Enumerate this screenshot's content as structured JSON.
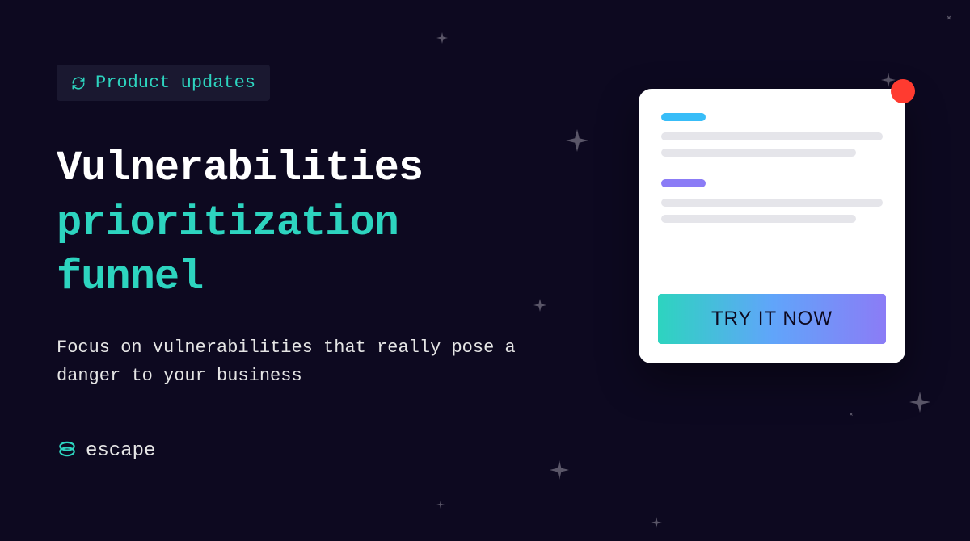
{
  "badge": {
    "label": "Product updates"
  },
  "title": {
    "line1": "Vulnerabilities",
    "line2": "prioritization",
    "line3": "funnel"
  },
  "subtitle": "Focus on vulnerabilities that really pose a danger to your business",
  "brand": {
    "name": "escape"
  },
  "cta": {
    "label": "TRY IT NOW"
  }
}
